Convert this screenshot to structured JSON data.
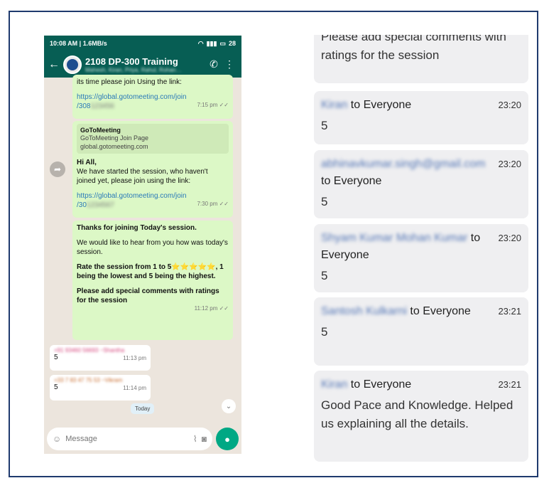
{
  "phone": {
    "status": {
      "time": "10:08 AM | 1.6MB/s",
      "battery": "28"
    },
    "header": {
      "title": "2108 DP-300 Training",
      "subtitle": "Mahesh, Kiran, Priya, Rahul, Rohan…"
    },
    "messages": [
      {
        "text1": "its time please join Using the link:",
        "link1": "https://global.gotomeeting.com/join",
        "link2": "/308",
        "link_blur": "123456",
        "time": "7:15 pm"
      },
      {
        "preview_title": "GoToMeeting",
        "preview_sub": "GoToMeeting Join Page",
        "preview_url": "global.gotomeeting.com",
        "greeting": "Hi All,",
        "text": "We have started the session, who haven't joined yet, please join using the link:",
        "link1": "https://global.gotomeeting.com/join",
        "link2": "/30",
        "link_blur": "1234567",
        "time": "7:30 pm"
      },
      {
        "line1": "Thanks for joining Today's session.",
        "line2": "We would like to hear from you how was today's session.",
        "line3": "Rate the session from 1 to 5⭐⭐⭐⭐⭐, 1 being the lowest and 5 being the highest.",
        "line4": "Please add special comments with ratings for the session",
        "time": "11:12 pm"
      }
    ],
    "replies": [
      {
        "sender": "+91 93460 56693 ~Shantha",
        "text": "5",
        "time": "11:13 pm"
      },
      {
        "sender": "+33 7 83 47 75 53 ~Vikram",
        "text": "5",
        "time": "11:14 pm"
      }
    ],
    "today_label": "Today",
    "input": {
      "placeholder": "Message"
    }
  },
  "cards": [
    {
      "body": "Please add special comments with ratings for the session"
    },
    {
      "name_blur": "Kiran",
      "name": " to Everyone",
      "time": "23:20",
      "body": "5"
    },
    {
      "name_blur": "abhinavkumar.singh@gmail.com",
      "name": "to Everyone",
      "time": "23:20",
      "body": "5"
    },
    {
      "name_blur": "Shyam Kumar Mohan Kumar",
      "name": " to Everyone",
      "time": "23:20",
      "body": "5"
    },
    {
      "name_blur": "Santosh Kulkarni",
      "name": " to Everyone",
      "time": "23:21",
      "body": "5"
    },
    {
      "name_blur": "Kiran",
      "name": " to Everyone",
      "time": "23:21",
      "body": "Good Pace and Knowledge. Helped us explaining all the details."
    }
  ]
}
